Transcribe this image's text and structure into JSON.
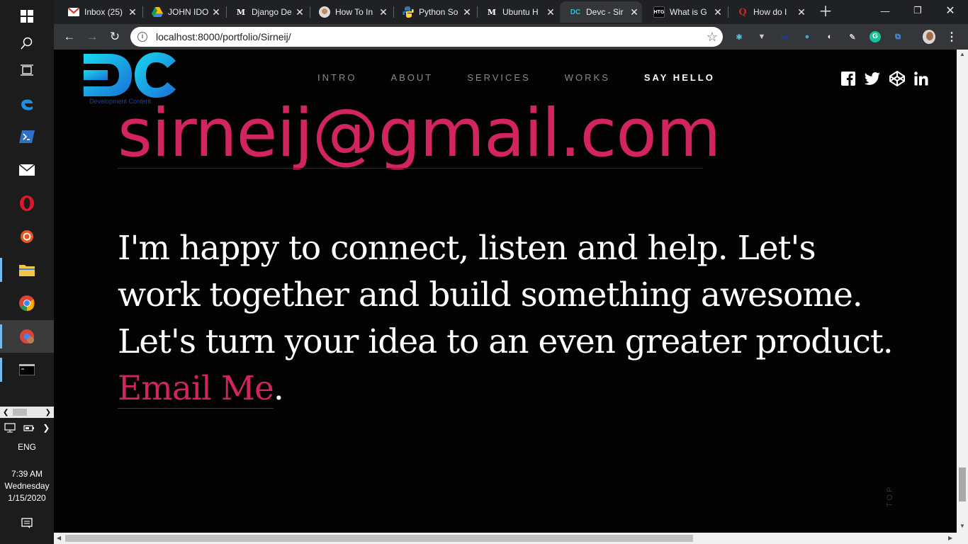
{
  "taskbar": {
    "apps": [
      "windows-start",
      "search",
      "task-view",
      "edge",
      "powershell",
      "mail",
      "opera",
      "ubuntu",
      "file-explorer",
      "chrome",
      "chrome-profile",
      "terminal"
    ],
    "language": "ENG",
    "time": "7:39 AM",
    "day": "Wednesday",
    "date": "1/15/2020"
  },
  "browser": {
    "tabs": [
      {
        "title": "Inbox (25)",
        "icon": "gmail-icon"
      },
      {
        "title": "JOHN IDO",
        "icon": "drive-icon"
      },
      {
        "title": "Django De",
        "icon": "medium-icon"
      },
      {
        "title": "How To In",
        "icon": "avatar-icon"
      },
      {
        "title": "Python So",
        "icon": "python-icon"
      },
      {
        "title": "Ubuntu H",
        "icon": "medium-icon"
      },
      {
        "title": "Devc - Sir",
        "icon": "devc-icon",
        "active": true
      },
      {
        "title": "What is G",
        "icon": "htg-icon"
      },
      {
        "title": "How do I",
        "icon": "quora-icon"
      }
    ],
    "url": "localhost:8000/portfolio/Sirneij/"
  },
  "site": {
    "logo_text": "DC",
    "logo_tagline": "Development Content",
    "nav": [
      {
        "label": "INTRO",
        "current": false
      },
      {
        "label": "ABOUT",
        "current": false
      },
      {
        "label": "SERVICES",
        "current": false
      },
      {
        "label": "WORKS",
        "current": false
      },
      {
        "label": "SAY HELLO",
        "current": true
      }
    ],
    "social": [
      "facebook-icon",
      "twitter-icon",
      "codepen-icon",
      "linkedin-icon"
    ],
    "email": "sirneij@gmail.com",
    "message": "I'm happy to connect, listen and help. Let's work together and build something awesome. Let's turn your idea to an even greater product.",
    "cta": "Email Me",
    "cta_suffix": ".",
    "top_label": "TOP"
  },
  "colors": {
    "accent": "#d2245f",
    "background": "#030303",
    "logo_cyan": "#16c7e8",
    "logo_blue": "#1c3fa8"
  }
}
